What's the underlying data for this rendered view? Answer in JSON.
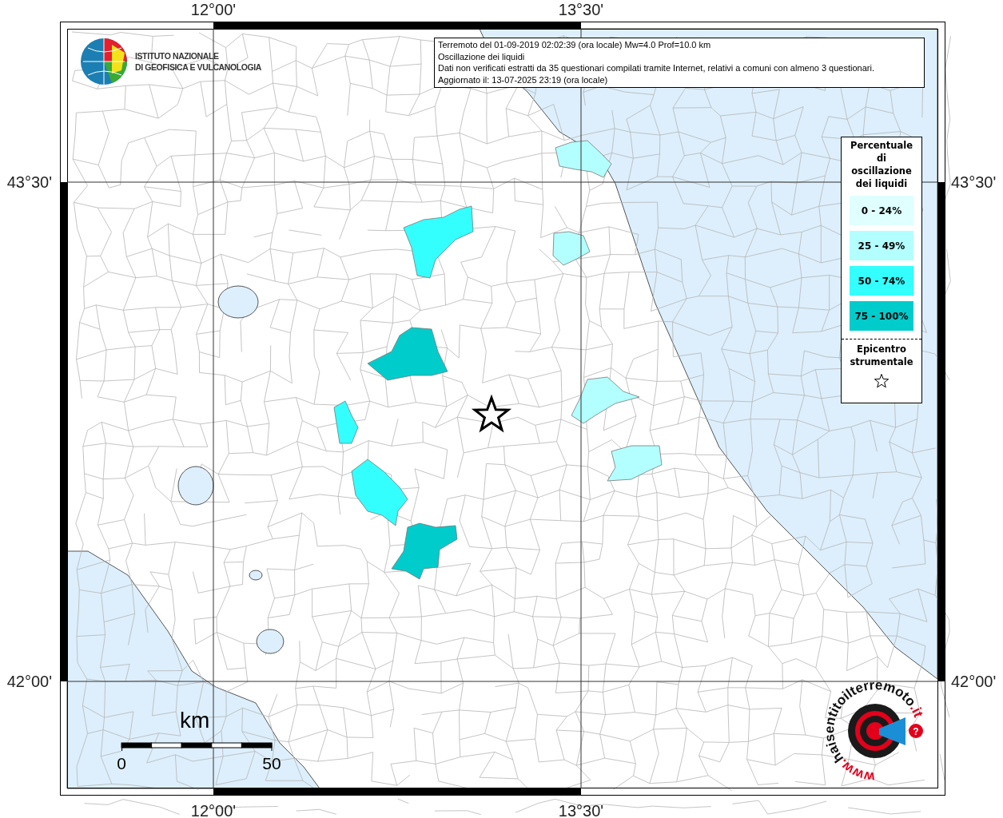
{
  "axis_labels": {
    "top": [
      "12°00'",
      "13°30'"
    ],
    "bottom": [
      "12°00'",
      "13°30'"
    ],
    "left": [
      "43°30'",
      "42°00'"
    ],
    "right": [
      "43°30'",
      "42°00'"
    ]
  },
  "info_box": {
    "lines": [
      "Terremoto del 01-09-2019 02:02:39 (ora locale) Mw=4.0 Prof=10.0 km",
      "Oscillazione dei liquidi",
      "Dati non verificati estratti da 35 questionari compilati tramite Internet, relativi a comuni con almeno 3 questionari.",
      "Aggiornato il: 13-07-2025 23:19 (ora locale)"
    ]
  },
  "institute_logo": {
    "lines": [
      "ISTITUTO NAZIONALE",
      "DI GEOFISICA E VULCANOLOGIA"
    ]
  },
  "legend": {
    "title": "Percentuale di oscillazione dei liquidi",
    "classes": [
      {
        "label": "0 - 24%",
        "color": "#e0ffff"
      },
      {
        "label": "25 - 49%",
        "color": "#b3ffff"
      },
      {
        "label": "50 - 74%",
        "color": "#33ffff"
      },
      {
        "label": "75 - 100%",
        "color": "#00cccc"
      }
    ],
    "epicenter_label": "Epicentro strumentale"
  },
  "regions": [
    {
      "color": "#b3ffff"
    },
    {
      "color": "#33ffff"
    },
    {
      "color": "#b3ffff"
    },
    {
      "color": "#00cccc"
    },
    {
      "color": "#33ffff"
    },
    {
      "color": "#b3ffff"
    },
    {
      "color": "#b3ffff"
    },
    {
      "color": "#33ffff"
    },
    {
      "color": "#00cccc"
    }
  ],
  "scale_bar": {
    "unit": "km",
    "labels": [
      "0",
      "50"
    ]
  },
  "site_logo": {
    "prefix": "www.",
    "name": "haisentitoilterremoto",
    "suffix": ".it",
    "badge": "?"
  }
}
